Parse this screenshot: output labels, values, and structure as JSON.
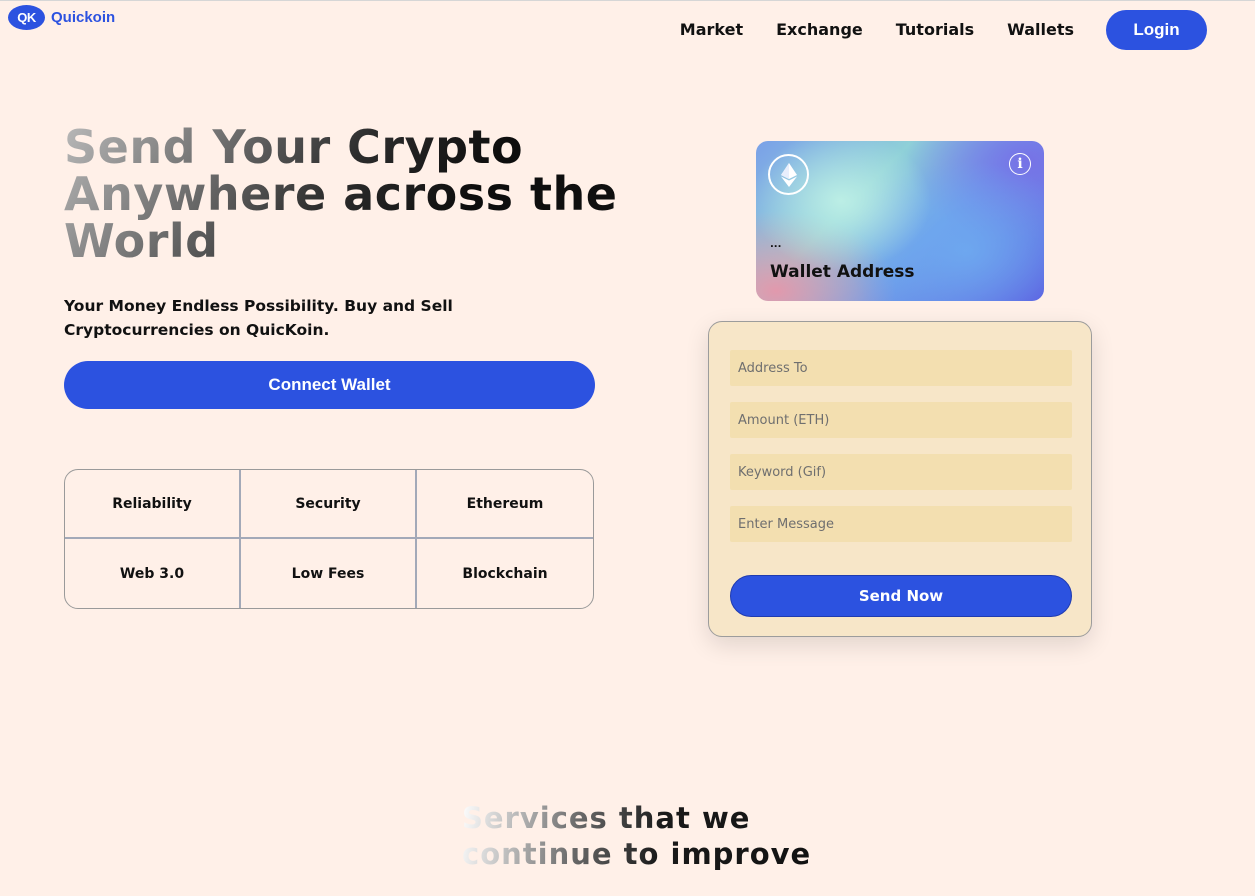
{
  "brand": {
    "badge": "QK",
    "name": "Quickoin"
  },
  "nav": {
    "items": [
      {
        "label": "Market"
      },
      {
        "label": "Exchange"
      },
      {
        "label": "Tutorials"
      },
      {
        "label": "Wallets"
      }
    ],
    "login_label": "Login"
  },
  "hero": {
    "title": "Send Your Crypto Anywhere across the World",
    "subtitle": "Your Money Endless Possibility. Buy and Sell Cryptocurrencies on QuicKoin.",
    "connect_label": "Connect Wallet"
  },
  "features": [
    {
      "label": "Reliability"
    },
    {
      "label": "Security"
    },
    {
      "label": "Ethereum"
    },
    {
      "label": "Web 3.0"
    },
    {
      "label": "Low Fees"
    },
    {
      "label": "Blockchain"
    }
  ],
  "card": {
    "address_short": "...",
    "label": "Wallet Address",
    "icons": [
      "ethereum-icon",
      "info-icon"
    ]
  },
  "form": {
    "address_placeholder": "Address To",
    "amount_placeholder": "Amount (ETH)",
    "keyword_placeholder": "Keyword (Gif)",
    "message_placeholder": "Enter Message",
    "send_label": "Send Now"
  },
  "services": {
    "title": "Services that we continue to improve"
  },
  "colors": {
    "background": "#fff0e8",
    "accent": "#2c52e0",
    "form_bg": "#f7e6c8",
    "input_bg": "#f3dfb0"
  }
}
